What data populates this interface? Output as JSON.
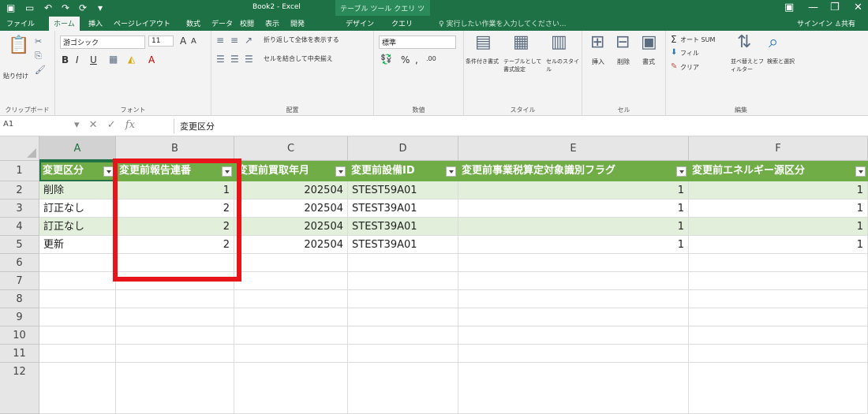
{
  "window": {
    "title": "Book2 - Excel",
    "contextual_tabs": [
      "テーブル ツール",
      "クエリ ツール"
    ],
    "quick_access_icons": [
      "save-icon",
      "undo-icon",
      "redo-icon",
      "screenshot-icon"
    ],
    "controls": [
      "restore-icon",
      "minimize-icon",
      "maximize-icon",
      "close-icon"
    ]
  },
  "tabs": [
    {
      "label": "ファイル"
    },
    {
      "label": "ホーム"
    },
    {
      "label": "挿入"
    },
    {
      "label": "ページレイアウト"
    },
    {
      "label": "数式"
    },
    {
      "label": "データ"
    },
    {
      "label": "校閲"
    },
    {
      "label": "表示"
    },
    {
      "label": "開発"
    },
    {
      "label": "デザイン"
    },
    {
      "label": "クエリ"
    }
  ],
  "active_tab": "ホーム",
  "tell_me": "実行したい作業を入力してください...",
  "sign_in": "サインイン",
  "share": "共有",
  "ribbon": {
    "clipboard": {
      "label": "クリップボード",
      "paste": "貼り付け"
    },
    "font": {
      "label": "フォント",
      "name": "游ゴシック",
      "size": "11",
      "bold": "B",
      "italic": "I",
      "underline": "U"
    },
    "alignment": {
      "label": "配置",
      "wrap": "折り返して全体を表示する",
      "merge": "セルを結合して中央揃え"
    },
    "number": {
      "label": "数値",
      "format": "標準",
      "percent": "%",
      "comma": ","
    },
    "styles": {
      "label": "スタイル",
      "conditional": "条件付き書式",
      "table": "テーブルとして書式設定",
      "cell": "セルのスタイル"
    },
    "cells": {
      "label": "セル",
      "insert": "挿入",
      "delete": "削除",
      "format": "書式"
    },
    "editing": {
      "label": "編集",
      "autosum": "オート SUM",
      "fill": "フィル",
      "clear": "クリア",
      "sort": "並べ替えとフィルター",
      "find": "検索と選択"
    }
  },
  "formula_bar": {
    "name_box": "A1",
    "fx": "fx",
    "content": "変更区分"
  },
  "sheet": {
    "columns": [
      "A",
      "B",
      "C",
      "D",
      "E",
      "F"
    ],
    "selected_column": "A",
    "row_numbers": [
      "1",
      "2",
      "3",
      "4",
      "5",
      "6",
      "7",
      "8",
      "9",
      "10",
      "11",
      "12"
    ],
    "header_row": [
      "変更区分",
      "変更前報告連番",
      "変更前買取年月",
      "変更前設備ID",
      "変更前事業税算定対象識別フラグ",
      "変更前エネルギー源区分"
    ],
    "rows": [
      [
        "削除",
        "1",
        "202504",
        "STEST59A01",
        "1",
        "1"
      ],
      [
        "訂正なし",
        "2",
        "202504",
        "STEST39A01",
        "1",
        "1"
      ],
      [
        "訂正なし",
        "2",
        "202504",
        "STEST39A01",
        "1",
        "1"
      ],
      [
        "更新",
        "2",
        "202504",
        "STEST39A01",
        "1",
        "1"
      ]
    ],
    "selected_cell": "A1"
  },
  "colors": {
    "excel_green": "#1e7145",
    "table_header": "#70ad47",
    "table_band": "#e2efda",
    "highlight_box": "#e8141b"
  }
}
